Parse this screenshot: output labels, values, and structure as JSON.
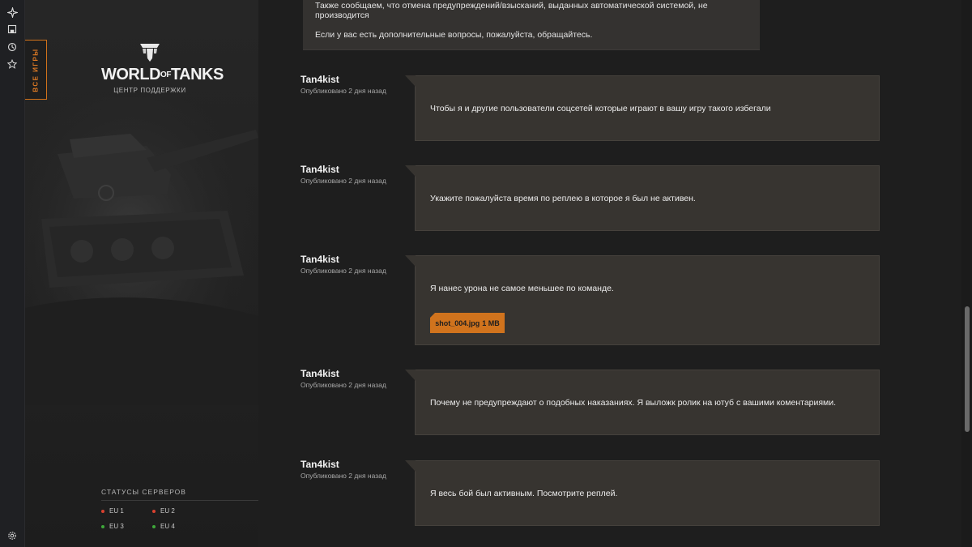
{
  "side": {
    "all_games": "ВСЕ ИГРЫ",
    "logo_word_a": "WORLD",
    "logo_word_of": "OF",
    "logo_word_b": "TANKS",
    "logo_sub": "ЦЕНТР ПОДДЕРЖКИ",
    "server_status_title": "СТАТУСЫ СЕРВЕРОВ",
    "servers": [
      {
        "name": "EU 1",
        "status_color": "#d9412f"
      },
      {
        "name": "EU 2",
        "status_color": "#d9412f"
      },
      {
        "name": "EU 3",
        "status_color": "#3fa83a"
      },
      {
        "name": "EU 4",
        "status_color": "#3fa83a"
      }
    ]
  },
  "top_message": {
    "line1": "Также сообщаем, что отмена предупреждений/взысканий, выданных автоматической системой, не",
    "line2": "производится",
    "line3": "Если у вас есть дополнительные вопросы, пожалуйста, обращайтесь."
  },
  "comments": [
    {
      "author": "Tan4kist",
      "posted": "Опубликовано 2 дня назад",
      "text": "Чтобы я и другие пользователи соцсетей которые играют в вашу игру такого избегали"
    },
    {
      "author": "Tan4kist",
      "posted": "Опубликовано 2 дня назад",
      "text": "Укажите пожалуйста время по реплею в которое я был не активен."
    },
    {
      "author": "Tan4kist",
      "posted": "Опубликовано 2 дня назад",
      "text": "Я нанес урона не самое меньшее по команде.",
      "attachment": {
        "name": "shot_004.jpg",
        "size": "1 MB"
      }
    },
    {
      "author": "Tan4kist",
      "posted": "Опубликовано 2 дня назад",
      "text": "Почему не предупреждают о подобных наказаниях. Я выложк ролик на ютуб с вашими коментариями."
    },
    {
      "author": "Tan4kist",
      "posted": "Опубликовано 2 дня назад",
      "text": "Я весь бой был активным. Посмотрите реплей."
    }
  ],
  "colors": {
    "accent": "#d0731d",
    "bubble": "#373430",
    "background": "#1e1e1e"
  },
  "rail_icons": [
    "sparkle-icon",
    "save-page-icon",
    "history-icon",
    "star-icon",
    "settings-icon"
  ]
}
